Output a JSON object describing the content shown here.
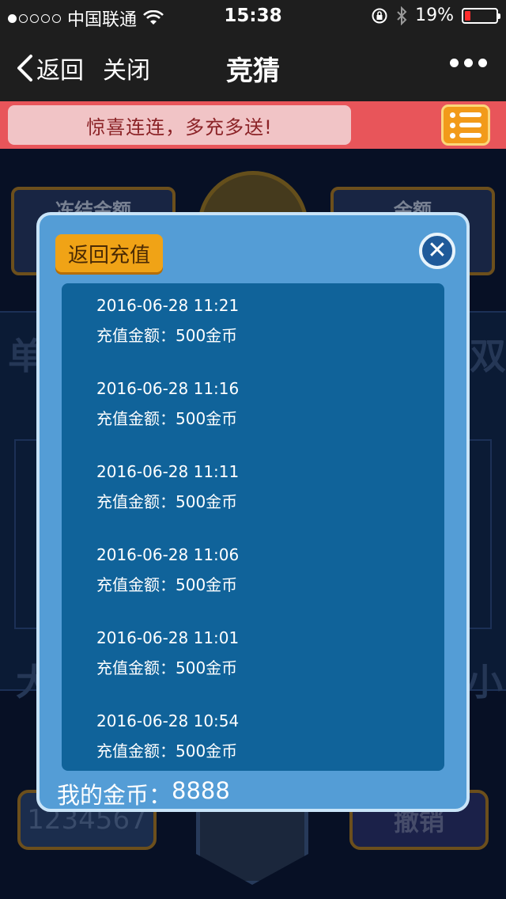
{
  "status_bar": {
    "carrier": "中国联通",
    "time": "15:38",
    "battery": "19%",
    "battery_level": 0.19,
    "signal_dots_filled": 1,
    "signal_dots_total": 5
  },
  "nav": {
    "back_label": "返回",
    "close_label": "关闭",
    "title": "竞猜"
  },
  "banner": {
    "text": "惊喜连连，多充多送!"
  },
  "background": {
    "frozen_label": "冻结金额",
    "balance_label": "余额",
    "input_value": "1234567",
    "cancel_label": "撤销"
  },
  "modal": {
    "back_button": "返回充值",
    "records": [
      {
        "date": "2016-06-28  11:21",
        "amount": "充值金额：500金币"
      },
      {
        "date": "2016-06-28  11:16",
        "amount": "充值金额：500金币"
      },
      {
        "date": "2016-06-28  11:11",
        "amount": "充值金额：500金币"
      },
      {
        "date": "2016-06-28  11:06",
        "amount": "充值金额：500金币"
      },
      {
        "date": "2016-06-28  11:01",
        "amount": "充值金额：500金币"
      },
      {
        "date": "2016-06-28  10:54",
        "amount": "充值金额：500金币"
      }
    ],
    "coins_label": "我的金币：",
    "coins_value": "8888"
  },
  "colors": {
    "accent_orange": "#f0a316",
    "modal_blue": "#549dd6",
    "list_blue": "#10639a",
    "banner_red": "#e8555a"
  }
}
